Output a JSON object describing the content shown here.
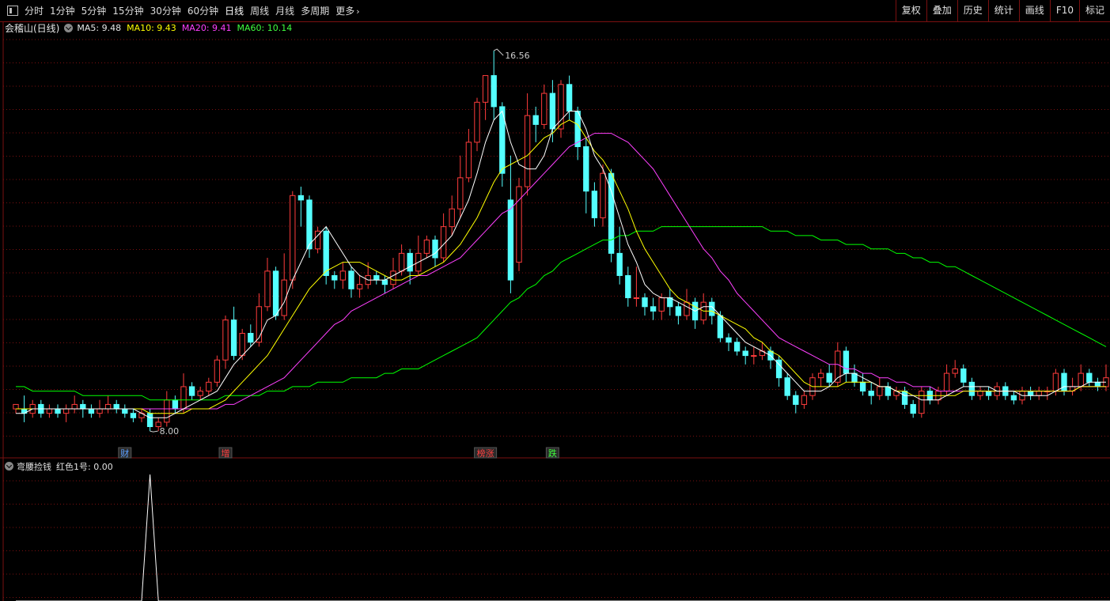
{
  "toolbar": {
    "periods": [
      "分时",
      "1分钟",
      "5分钟",
      "15分钟",
      "30分钟",
      "60分钟",
      "日线",
      "周线",
      "月线",
      "多周期",
      "更多"
    ],
    "active_period": "日线",
    "more_chevron": "›",
    "right_buttons": [
      "复权",
      "叠加",
      "历史",
      "统计",
      "画线",
      "F10",
      "标记"
    ]
  },
  "legend": {
    "stock": "会稽山(日线)",
    "ma5": "MA5: 9.48",
    "ma10": "MA10: 9.43",
    "ma20": "MA20: 9.41",
    "ma60": "MA60: 10.14"
  },
  "colors": {
    "up": "#ff3c3c",
    "down": "#54ffff",
    "ma5": "#ffffff",
    "ma10": "#ffff00",
    "ma20": "#ff40ff",
    "ma60": "#00ff00",
    "grid": "#7a1010"
  },
  "chart_data": {
    "type": "candlestick",
    "high_label": "16.56",
    "low_label": "8.00",
    "high": 16.56,
    "low": 8.0,
    "candles": [
      [
        8.5,
        8.6,
        8.4,
        8.5
      ],
      [
        8.5,
        8.4,
        8.8,
        8.2
      ],
      [
        8.4,
        8.6,
        8.7,
        8.3
      ],
      [
        8.6,
        8.4,
        8.7,
        8.3
      ],
      [
        8.4,
        8.5,
        8.6,
        8.3
      ],
      [
        8.5,
        8.4,
        8.6,
        8.3
      ],
      [
        8.4,
        8.5,
        8.6,
        8.2
      ],
      [
        8.5,
        8.6,
        8.8,
        8.4
      ],
      [
        8.6,
        8.5,
        8.7,
        8.3
      ],
      [
        8.5,
        8.4,
        8.6,
        8.3
      ],
      [
        8.4,
        8.5,
        8.7,
        8.3
      ],
      [
        8.5,
        8.6,
        8.8,
        8.4
      ],
      [
        8.6,
        8.5,
        8.7,
        8.4
      ],
      [
        8.5,
        8.4,
        8.6,
        8.3
      ],
      [
        8.4,
        8.3,
        8.5,
        8.2
      ],
      [
        8.3,
        8.4,
        8.5,
        8.2
      ],
      [
        8.4,
        8.1,
        8.5,
        8.0
      ],
      [
        8.1,
        8.2,
        8.3,
        8.0
      ],
      [
        8.2,
        8.7,
        8.9,
        8.1
      ],
      [
        8.7,
        8.5,
        8.8,
        8.4
      ],
      [
        8.5,
        9.0,
        9.3,
        8.4
      ],
      [
        9.0,
        8.8,
        9.1,
        8.7
      ],
      [
        8.8,
        8.9,
        9.0,
        8.7
      ],
      [
        8.9,
        9.1,
        9.2,
        8.8
      ],
      [
        9.1,
        9.6,
        9.7,
        9.0
      ],
      [
        9.6,
        10.5,
        10.6,
        9.4
      ],
      [
        10.5,
        9.7,
        10.8,
        9.6
      ],
      [
        9.7,
        10.2,
        10.3,
        9.6
      ],
      [
        10.2,
        10.0,
        10.4,
        9.9
      ],
      [
        10.0,
        10.8,
        11.1,
        9.9
      ],
      [
        10.8,
        11.6,
        11.9,
        10.7
      ],
      [
        11.6,
        10.6,
        11.7,
        10.5
      ],
      [
        10.6,
        11.4,
        12.0,
        10.5
      ],
      [
        11.4,
        13.3,
        13.4,
        11.2
      ],
      [
        13.3,
        13.2,
        13.5,
        12.6
      ],
      [
        13.2,
        12.1,
        13.3,
        11.9
      ],
      [
        12.1,
        12.5,
        12.6,
        12.0
      ],
      [
        12.5,
        11.5,
        12.6,
        11.3
      ],
      [
        11.5,
        11.4,
        11.6,
        11.2
      ],
      [
        11.4,
        11.6,
        11.8,
        11.2
      ],
      [
        11.6,
        11.2,
        11.7,
        11.0
      ],
      [
        11.2,
        11.3,
        11.5,
        11.0
      ],
      [
        11.3,
        11.5,
        11.8,
        11.2
      ],
      [
        11.5,
        11.4,
        11.6,
        11.3
      ],
      [
        11.4,
        11.3,
        11.5,
        11.1
      ],
      [
        11.3,
        11.6,
        11.9,
        11.2
      ],
      [
        11.6,
        12.0,
        12.2,
        11.5
      ],
      [
        12.0,
        11.6,
        12.1,
        11.3
      ],
      [
        11.6,
        12.0,
        12.4,
        11.5
      ],
      [
        12.0,
        12.3,
        12.4,
        11.9
      ],
      [
        12.3,
        11.9,
        12.4,
        11.7
      ],
      [
        11.9,
        12.6,
        12.9,
        11.8
      ],
      [
        12.6,
        13.0,
        13.3,
        12.4
      ],
      [
        13.0,
        13.7,
        14.2,
        12.8
      ],
      [
        13.7,
        14.5,
        14.8,
        13.6
      ],
      [
        14.5,
        15.4,
        15.5,
        14.3
      ],
      [
        15.4,
        16.0,
        16.0,
        15.0
      ],
      [
        16.0,
        15.3,
        16.56,
        15.0
      ],
      [
        15.3,
        13.8,
        15.4,
        13.5
      ],
      [
        13.2,
        11.4,
        14.2,
        11.1
      ],
      [
        11.8,
        13.5,
        13.7,
        11.6
      ],
      [
        13.5,
        15.1,
        15.6,
        13.3
      ],
      [
        15.1,
        14.9,
        15.3,
        14.5
      ],
      [
        14.9,
        15.6,
        15.8,
        14.8
      ],
      [
        15.6,
        14.8,
        15.9,
        14.5
      ],
      [
        14.8,
        15.8,
        15.9,
        14.6
      ],
      [
        15.8,
        15.2,
        16.0,
        15.0
      ],
      [
        15.2,
        14.4,
        15.3,
        14.1
      ],
      [
        14.4,
        13.4,
        14.6,
        12.9
      ],
      [
        13.4,
        12.8,
        13.6,
        12.6
      ],
      [
        12.8,
        13.8,
        14.0,
        12.6
      ],
      [
        13.8,
        12.0,
        13.9,
        11.8
      ],
      [
        12.0,
        11.5,
        12.6,
        11.3
      ],
      [
        11.5,
        11.0,
        11.7,
        10.8
      ],
      [
        11.0,
        11.0,
        11.7,
        10.8
      ],
      [
        11.0,
        10.8,
        11.1,
        10.6
      ],
      [
        10.8,
        10.7,
        11.0,
        10.5
      ],
      [
        10.7,
        11.0,
        11.1,
        10.5
      ],
      [
        11.0,
        10.8,
        11.2,
        10.6
      ],
      [
        10.8,
        10.6,
        10.9,
        10.4
      ],
      [
        10.6,
        10.9,
        11.2,
        10.5
      ],
      [
        10.9,
        10.5,
        11.0,
        10.3
      ],
      [
        10.5,
        10.9,
        11.1,
        10.4
      ],
      [
        10.9,
        10.6,
        11.0,
        10.4
      ],
      [
        10.6,
        10.1,
        10.7,
        10.0
      ],
      [
        10.1,
        10.0,
        10.2,
        9.8
      ],
      [
        10.0,
        9.8,
        10.1,
        9.7
      ],
      [
        9.8,
        9.7,
        9.9,
        9.5
      ],
      [
        9.7,
        9.7,
        9.9,
        9.5
      ],
      [
        9.7,
        9.8,
        10.0,
        9.6
      ],
      [
        9.8,
        9.6,
        9.9,
        9.4
      ],
      [
        9.6,
        9.2,
        9.7,
        9.0
      ],
      [
        9.2,
        8.8,
        9.3,
        8.7
      ],
      [
        8.8,
        8.6,
        8.9,
        8.4
      ],
      [
        8.6,
        8.8,
        8.9,
        8.5
      ],
      [
        8.8,
        9.2,
        9.3,
        8.7
      ],
      [
        9.2,
        9.3,
        9.4,
        9.0
      ],
      [
        9.3,
        9.1,
        9.5,
        9.0
      ],
      [
        9.1,
        9.8,
        10.0,
        9.0
      ],
      [
        9.8,
        9.3,
        9.9,
        9.1
      ],
      [
        9.3,
        9.1,
        9.5,
        9.0
      ],
      [
        9.1,
        8.9,
        9.3,
        8.8
      ],
      [
        8.9,
        8.8,
        9.1,
        8.6
      ],
      [
        8.8,
        9.0,
        9.2,
        8.7
      ],
      [
        9.0,
        8.8,
        9.1,
        8.7
      ],
      [
        8.8,
        8.9,
        9.0,
        8.7
      ],
      [
        8.9,
        8.6,
        9.0,
        8.5
      ],
      [
        8.6,
        8.4,
        8.7,
        8.3
      ],
      [
        8.4,
        8.9,
        9.0,
        8.3
      ],
      [
        8.9,
        8.7,
        9.0,
        8.6
      ],
      [
        8.7,
        8.9,
        9.0,
        8.6
      ],
      [
        8.9,
        9.3,
        9.5,
        8.8
      ],
      [
        9.3,
        9.4,
        9.6,
        9.2
      ],
      [
        9.4,
        9.1,
        9.5,
        9.0
      ],
      [
        9.1,
        8.8,
        9.2,
        8.7
      ],
      [
        8.8,
        8.9,
        9.0,
        8.7
      ],
      [
        8.9,
        8.8,
        9.0,
        8.7
      ],
      [
        8.8,
        9.0,
        9.1,
        8.7
      ],
      [
        9.0,
        8.8,
        9.1,
        8.7
      ],
      [
        8.8,
        8.7,
        8.9,
        8.6
      ],
      [
        8.7,
        8.9,
        9.0,
        8.6
      ],
      [
        8.9,
        8.8,
        9.0,
        8.7
      ],
      [
        8.8,
        8.9,
        9.0,
        8.7
      ],
      [
        8.9,
        8.9,
        9.0,
        8.7
      ],
      [
        8.9,
        9.3,
        9.4,
        8.8
      ],
      [
        9.3,
        8.9,
        9.4,
        8.8
      ],
      [
        8.9,
        9.0,
        9.2,
        8.8
      ],
      [
        9.0,
        9.3,
        9.5,
        8.9
      ],
      [
        9.3,
        9.1,
        9.4,
        9.0
      ],
      [
        9.1,
        9.0,
        9.2,
        8.9
      ],
      [
        9.0,
        9.2,
        9.5,
        8.9
      ]
    ],
    "ma5": [
      8.4,
      8.4,
      8.5,
      8.5,
      8.5,
      8.5,
      8.5,
      8.5,
      8.5,
      8.5,
      8.5,
      8.5,
      8.5,
      8.5,
      8.5,
      8.4,
      8.3,
      8.3,
      8.3,
      8.4,
      8.5,
      8.6,
      8.7,
      8.8,
      8.9,
      9.2,
      9.5,
      9.7,
      9.9,
      10.1,
      10.5,
      10.6,
      10.9,
      11.4,
      11.8,
      12.2,
      12.4,
      12.6,
      12.3,
      12.0,
      11.7,
      11.5,
      11.4,
      11.4,
      11.4,
      11.5,
      11.6,
      11.7,
      11.8,
      11.9,
      12.0,
      12.2,
      12.4,
      12.8,
      13.2,
      13.8,
      14.5,
      15.0,
      15.2,
      14.5,
      14.0,
      13.9,
      13.9,
      14.2,
      14.8,
      15.0,
      15.2,
      15.2,
      14.8,
      14.2,
      13.9,
      13.4,
      12.8,
      12.2,
      11.8,
      11.3,
      11.1,
      11.0,
      11.0,
      10.9,
      10.8,
      10.7,
      10.8,
      10.8,
      10.6,
      10.4,
      10.2,
      10.0,
      9.9,
      9.8,
      9.7,
      9.5,
      9.3,
      9.1,
      8.9,
      8.9,
      8.9,
      9.0,
      9.2,
      9.3,
      9.3,
      9.2,
      9.1,
      9.0,
      9.0,
      8.9,
      8.8,
      8.8,
      8.7,
      8.7,
      8.7,
      8.8,
      8.9,
      9.0,
      9.0,
      9.0,
      9.0,
      8.9,
      8.9,
      8.9,
      8.8,
      8.8,
      8.8,
      8.8,
      8.9,
      9.0,
      9.0,
      9.0,
      9.1,
      9.1,
      9.1
    ],
    "ma10": [
      8.5,
      8.5,
      8.5,
      8.5,
      8.5,
      8.5,
      8.5,
      8.5,
      8.5,
      8.5,
      8.5,
      8.5,
      8.5,
      8.5,
      8.5,
      8.5,
      8.4,
      8.4,
      8.4,
      8.4,
      8.4,
      8.5,
      8.5,
      8.5,
      8.6,
      8.7,
      8.9,
      9.1,
      9.3,
      9.5,
      9.7,
      10.0,
      10.3,
      10.6,
      10.9,
      11.2,
      11.4,
      11.6,
      11.7,
      11.8,
      11.8,
      11.8,
      11.7,
      11.6,
      11.5,
      11.4,
      11.4,
      11.5,
      11.5,
      11.6,
      11.7,
      11.8,
      12.0,
      12.2,
      12.5,
      12.8,
      13.2,
      13.6,
      13.9,
      14.0,
      14.1,
      14.2,
      14.4,
      14.6,
      14.7,
      14.9,
      15.0,
      14.9,
      14.6,
      14.3,
      14.1,
      13.8,
      13.4,
      13.0,
      12.5,
      12.1,
      11.8,
      11.5,
      11.2,
      11.0,
      10.9,
      10.8,
      10.7,
      10.7,
      10.6,
      10.5,
      10.4,
      10.3,
      10.1,
      10.0,
      9.8,
      9.7,
      9.5,
      9.3,
      9.1,
      9.0,
      9.0,
      9.0,
      9.0,
      9.1,
      9.1,
      9.1,
      9.1,
      9.0,
      9.0,
      8.9,
      8.9,
      8.8,
      8.8,
      8.8,
      8.8,
      8.8,
      8.8,
      8.9,
      8.9,
      8.9,
      8.9,
      8.9,
      8.9,
      8.9,
      8.9,
      8.9,
      8.9,
      8.9,
      8.9,
      8.9,
      8.9,
      9.0,
      9.0,
      9.0,
      9.0
    ],
    "ma20": [
      8.5,
      8.5,
      8.5,
      8.5,
      8.5,
      8.5,
      8.5,
      8.5,
      8.5,
      8.5,
      8.5,
      8.5,
      8.5,
      8.5,
      8.5,
      8.5,
      8.5,
      8.5,
      8.5,
      8.5,
      8.5,
      8.5,
      8.5,
      8.5,
      8.5,
      8.6,
      8.6,
      8.7,
      8.8,
      8.9,
      9.0,
      9.1,
      9.2,
      9.4,
      9.6,
      9.8,
      10.0,
      10.2,
      10.4,
      10.5,
      10.7,
      10.8,
      10.9,
      11.0,
      11.1,
      11.2,
      11.3,
      11.4,
      11.5,
      11.5,
      11.6,
      11.7,
      11.8,
      11.9,
      12.1,
      12.3,
      12.5,
      12.7,
      12.9,
      13.0,
      13.2,
      13.4,
      13.6,
      13.8,
      14.0,
      14.2,
      14.4,
      14.5,
      14.6,
      14.7,
      14.7,
      14.7,
      14.6,
      14.5,
      14.3,
      14.1,
      13.9,
      13.6,
      13.3,
      13.0,
      12.7,
      12.4,
      12.1,
      11.9,
      11.6,
      11.4,
      11.1,
      10.9,
      10.7,
      10.5,
      10.3,
      10.1,
      10.0,
      9.9,
      9.8,
      9.7,
      9.6,
      9.5,
      9.5,
      9.4,
      9.4,
      9.3,
      9.3,
      9.2,
      9.2,
      9.1,
      9.1,
      9.0,
      9.0,
      9.0,
      8.9,
      8.9,
      8.9,
      8.9,
      8.9,
      8.9,
      8.9,
      8.9,
      8.9,
      8.9,
      8.9,
      8.9,
      8.9,
      8.9,
      8.9,
      8.9,
      8.9,
      9.0,
      9.0,
      9.0,
      9.0
    ],
    "ma60": [
      9.0,
      9.0,
      8.9,
      8.9,
      8.9,
      8.9,
      8.9,
      8.9,
      8.8,
      8.8,
      8.8,
      8.8,
      8.8,
      8.8,
      8.8,
      8.8,
      8.7,
      8.7,
      8.7,
      8.7,
      8.7,
      8.7,
      8.7,
      8.7,
      8.7,
      8.8,
      8.8,
      8.8,
      8.8,
      8.8,
      8.9,
      8.9,
      8.9,
      9.0,
      9.0,
      9.0,
      9.1,
      9.1,
      9.1,
      9.1,
      9.2,
      9.2,
      9.2,
      9.2,
      9.3,
      9.3,
      9.4,
      9.4,
      9.4,
      9.5,
      9.6,
      9.7,
      9.8,
      9.9,
      10.0,
      10.1,
      10.3,
      10.5,
      10.7,
      10.9,
      11.0,
      11.2,
      11.3,
      11.5,
      11.6,
      11.8,
      11.9,
      12.0,
      12.1,
      12.2,
      12.3,
      12.3,
      12.4,
      12.4,
      12.5,
      12.5,
      12.5,
      12.6,
      12.6,
      12.6,
      12.6,
      12.6,
      12.6,
      12.6,
      12.6,
      12.6,
      12.6,
      12.6,
      12.6,
      12.6,
      12.5,
      12.5,
      12.5,
      12.4,
      12.4,
      12.4,
      12.3,
      12.3,
      12.3,
      12.2,
      12.2,
      12.2,
      12.1,
      12.1,
      12.1,
      12.0,
      12.0,
      11.9,
      11.9,
      11.8,
      11.8,
      11.7,
      11.7,
      11.6,
      11.5,
      11.4,
      11.3,
      11.2,
      11.1,
      11.0,
      10.9,
      10.8,
      10.7,
      10.6,
      10.5,
      10.4,
      10.3,
      10.2,
      10.1,
      10.0,
      9.9
    ],
    "events": [
      {
        "label": "财",
        "index": 13,
        "color": "#5aa0ff"
      },
      {
        "label": "增",
        "index": 25,
        "color": "#ff4040"
      },
      {
        "label": "榜涨",
        "index": 56,
        "color": "#ff4040"
      },
      {
        "label": "跌",
        "index": 64,
        "color": "#40ff40"
      }
    ],
    "indicator": {
      "name": "弯腰捡钱",
      "series_label": "红色1号: 0.00",
      "values": [
        0,
        0,
        0,
        0,
        0,
        0,
        0,
        0,
        0,
        0,
        0,
        0,
        0,
        0,
        0,
        0,
        1,
        0,
        0,
        0,
        0,
        0,
        0,
        0,
        0,
        0,
        0,
        0,
        0,
        0,
        0,
        0,
        0,
        0,
        0,
        0,
        0,
        0,
        0,
        0,
        0,
        0,
        0,
        0,
        0,
        0,
        0,
        0,
        0,
        0,
        0,
        0,
        0,
        0,
        0,
        0,
        0,
        0,
        0,
        0,
        0,
        0,
        0,
        0,
        0,
        0,
        0,
        0,
        0,
        0,
        0,
        0,
        0,
        0,
        0,
        0,
        0,
        0,
        0,
        0,
        0,
        0,
        0,
        0,
        0,
        0,
        0,
        0,
        0,
        0,
        0,
        0,
        0,
        0,
        0,
        0,
        0,
        0,
        0,
        0,
        0,
        0,
        0,
        0,
        0,
        0,
        0,
        0,
        0,
        0,
        0,
        0,
        0,
        0,
        0,
        0,
        0,
        0,
        0,
        0,
        0,
        0,
        0,
        0,
        0,
        0,
        0,
        0,
        0,
        0,
        0,
        0,
        0,
        0,
        0,
        0,
        0
      ]
    }
  }
}
